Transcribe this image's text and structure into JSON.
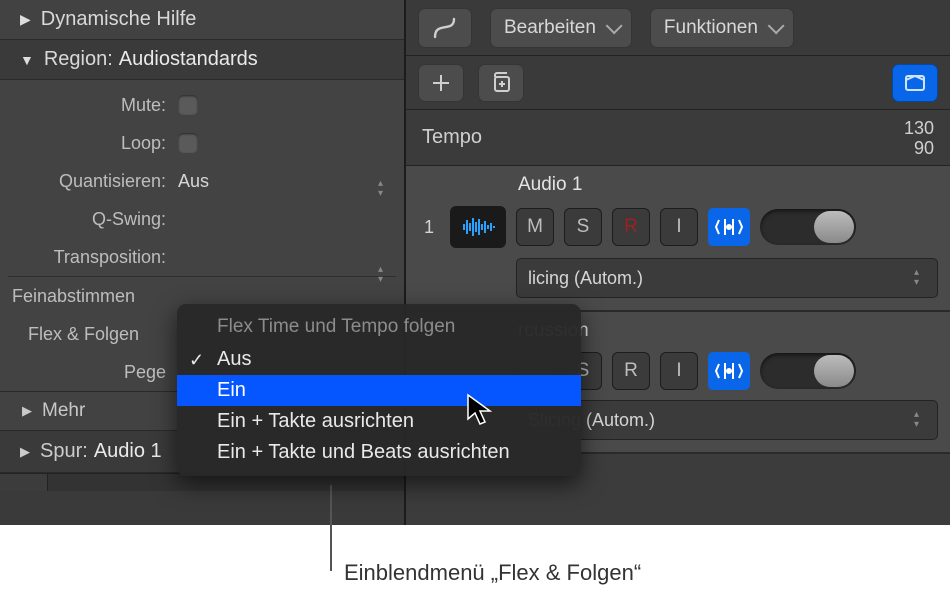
{
  "left": {
    "help_title": "Dynamische Hilfe",
    "region_label": "Region:",
    "region_value": "Audiostandards",
    "props": {
      "mute": "Mute:",
      "loop": "Loop:",
      "quantize_label": "Quantisieren:",
      "quantize_value": "Aus",
      "qswing": "Q-Swing:",
      "transposition": "Transposition:",
      "feinab": "Feinabstimmen",
      "flex_label": "Flex & Folgen",
      "pegel": "Pege"
    },
    "mehr": "Mehr",
    "spur_label": "Spur:",
    "spur_value": "Audio 1"
  },
  "toolbar": {
    "edit": "Bearbeiten",
    "functions": "Funktionen"
  },
  "tempo": {
    "label": "Tempo",
    "top": "130",
    "bottom": "90"
  },
  "tracks": [
    {
      "num": "1",
      "name": "Audio 1",
      "buttons": {
        "m": "M",
        "s": "S",
        "r": "R",
        "i": "I"
      },
      "mode": "licing (Autom.)"
    },
    {
      "num": "",
      "name": "rcussion",
      "buttons": {
        "m": "",
        "s": "S",
        "r": "R",
        "i": "I"
      },
      "mode": "Slicing (Autom.)"
    }
  ],
  "menu": {
    "title": "Flex Time und Tempo folgen",
    "items": [
      "Aus",
      "Ein",
      "Ein + Takte ausrichten",
      "Ein + Takte und Beats ausrichten"
    ],
    "checked": 0,
    "highlighted": 1
  },
  "callout": "Einblendmenü „Flex & Folgen“"
}
